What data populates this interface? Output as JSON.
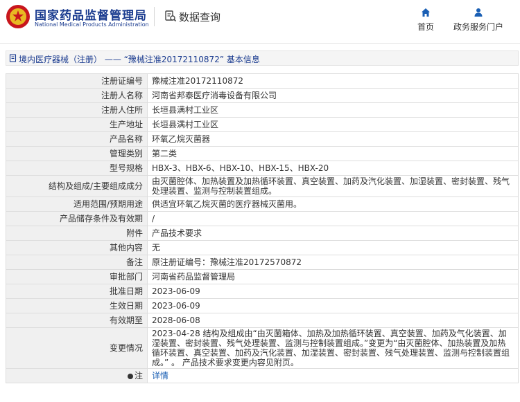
{
  "header": {
    "brand_cn": "国家药品监督管理局",
    "brand_en": "National Medical Products Administration",
    "db_title": "数据查询",
    "nav": [
      {
        "label": "首页",
        "icon": "home-icon"
      },
      {
        "label": "政务服务门户",
        "icon": "user-icon"
      }
    ]
  },
  "breadcrumb": {
    "text": "境内医疗器械（注册） —— “豫械注准20172110872” 基本信息"
  },
  "rows": [
    {
      "label": "注册证编号",
      "value": "豫械注准20172110872"
    },
    {
      "label": "注册人名称",
      "value": "河南省邦泰医疗消毒设备有限公司"
    },
    {
      "label": "注册人住所",
      "value": "长垣县满村工业区"
    },
    {
      "label": "生产地址",
      "value": "长垣县满村工业区"
    },
    {
      "label": "产品名称",
      "value": "环氧乙烷灭菌器"
    },
    {
      "label": "管理类别",
      "value": "第二类"
    },
    {
      "label": "型号规格",
      "value": "HBX-3、HBX-6、HBX-10、HBX-15、HBX-20"
    },
    {
      "label": "结构及组成/主要组成成分",
      "value": "由灭菌腔体、加热装置及加热循环装置、真空装置、加药及汽化装置、加湿装置、密封装置、残气处理装置、监测与控制装置组成。"
    },
    {
      "label": "适用范围/预期用途",
      "value": "供适宜环氧乙烷灭菌的医疗器械灭菌用。"
    },
    {
      "label": "产品储存条件及有效期",
      "value": "/"
    },
    {
      "label": "附件",
      "value": "产品技术要求"
    },
    {
      "label": "其他内容",
      "value": "无"
    },
    {
      "label": "备注",
      "value": "原注册证编号：豫械注准20172570872"
    },
    {
      "label": "审批部门",
      "value": "河南省药品监督管理局"
    },
    {
      "label": "批准日期",
      "value": "2023-06-09"
    },
    {
      "label": "生效日期",
      "value": "2023-06-09"
    },
    {
      "label": "有效期至",
      "value": "2028-06-08"
    },
    {
      "label": "变更情况",
      "value": "2023-04-28 结构及组成由“由灭菌箱体、加热及加热循环装置、真空装置、加药及气化装置、加湿装置、密封装置、残气处理装置、监测与控制装置组成。”变更为“由灭菌腔体、加热装置及加热循环装置、真空装置、加药及汽化装置、加湿装置、密封装置、残气处理装置、监测与控制装置组成。” 。 产品技术要求变更内容见附页。"
    }
  ],
  "note": {
    "label": "注",
    "link": "详情",
    "icon": "note-icon"
  }
}
